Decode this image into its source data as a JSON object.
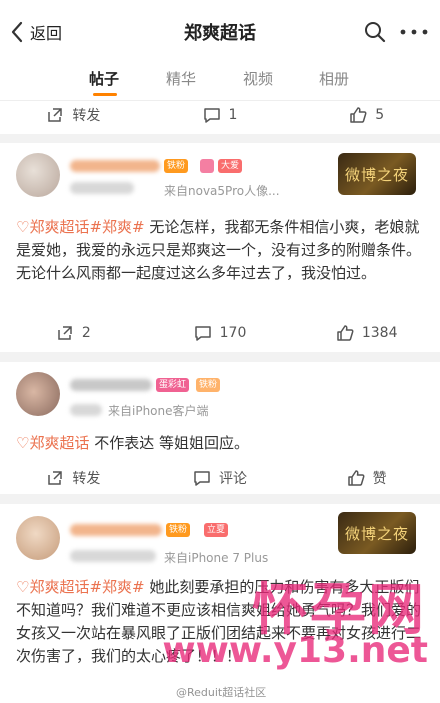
{
  "header": {
    "back_label": "返回",
    "title": "郑爽超话"
  },
  "tabs": [
    "帖子",
    "精华",
    "视频",
    "相册"
  ],
  "top_actions": {
    "repost": "转发",
    "comments": "1",
    "likes": "5"
  },
  "posts": [
    {
      "badges": {
        "level": "铁粉",
        "vip": "大爱"
      },
      "source": "来自nova5Pro人像...",
      "vip_label": "微博之夜",
      "tag": "♡郑爽超话#郑爽#",
      "text": " 无论怎样，我都无条件相信小爽，老娘就是爱她，我爱的永远只是郑爽这一个，没有过多的附赠条件。无论什么风雨都一起度过这么多年过去了，我没怕过。",
      "actions": {
        "repost": "2",
        "comments": "170",
        "likes": "1384"
      }
    },
    {
      "badges": {
        "level": "蛋彩虹",
        "fan": "铁粉"
      },
      "source": "来自iPhone客户端",
      "tag": "♡郑爽超话",
      "text": " 不作表达 等姐姐回应。",
      "actions": {
        "repost": "转发",
        "comments": "评论",
        "likes": "赞"
      }
    },
    {
      "badges": {
        "level": "铁粉",
        "vip": "立夏"
      },
      "source": "来自iPhone 7 Plus",
      "vip_label": "微博之夜",
      "tag": "♡郑爽超话#郑爽#",
      "text": " 她此刻要承担的压力和伤害有多大正版们不知道吗？我们难道不更应该相信爽姐给她勇气吗？我们爱的女孩又一次站在暴风眼了正版们团结起来不要再对女孩进行二次伤害了，我们的太心疼了！！！"
    }
  ],
  "watermark": {
    "big": "怀孕网",
    "url": "www.y13.net",
    "small": "@Reduit超话社区"
  },
  "colors": {
    "accent": "#ff8200",
    "topic": "#eb7350",
    "watermark": "#e82878"
  }
}
